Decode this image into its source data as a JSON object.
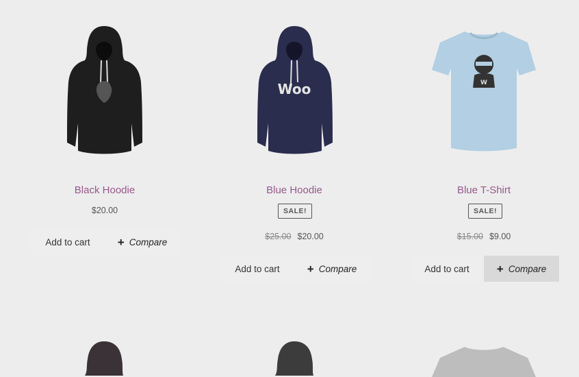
{
  "products": [
    {
      "name": "Black Hoodie",
      "image_icon": "black-hoodie-image",
      "price": "$20.00",
      "add_to_cart": "Add to cart",
      "compare": "Compare"
    },
    {
      "name": "Blue Hoodie",
      "image_icon": "blue-hoodie-image",
      "sale_badge": "SALE!",
      "old_price": "$25.00",
      "price": "$20.00",
      "add_to_cart": "Add to cart",
      "compare": "Compare"
    },
    {
      "name": "Blue T-Shirt",
      "image_icon": "blue-tshirt-image",
      "sale_badge": "SALE!",
      "old_price": "$15.00",
      "price": "$9.00",
      "add_to_cart": "Add to cart",
      "compare": "Compare"
    }
  ],
  "colors": {
    "title": "#96588a",
    "background": "#ededed",
    "button": "#eeeeee",
    "button_hover": "#d9d9d9"
  }
}
